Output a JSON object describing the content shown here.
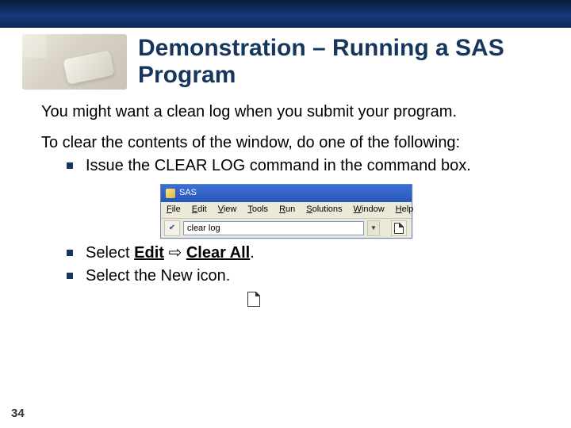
{
  "header": {
    "title": "Demonstration – Running a SAS Program"
  },
  "body": {
    "p1": "You might want a clean log when you submit your program.",
    "p2": "To clear the contents of the window, do one of the following:",
    "bullets_top": [
      "Issue the CLEAR LOG command in the command box."
    ],
    "bullets_bottom_prefix": "Select ",
    "edit_label": "Edit",
    "arrow": "⇨",
    "clear_all_label": "Clear All",
    "period": ".",
    "bullet_new": "Select the New icon."
  },
  "sas": {
    "app_title": "SAS",
    "menu": [
      "File",
      "Edit",
      "View",
      "Tools",
      "Run",
      "Solutions",
      "Window",
      "Help"
    ],
    "command_value": "clear log"
  },
  "page_number": "34"
}
